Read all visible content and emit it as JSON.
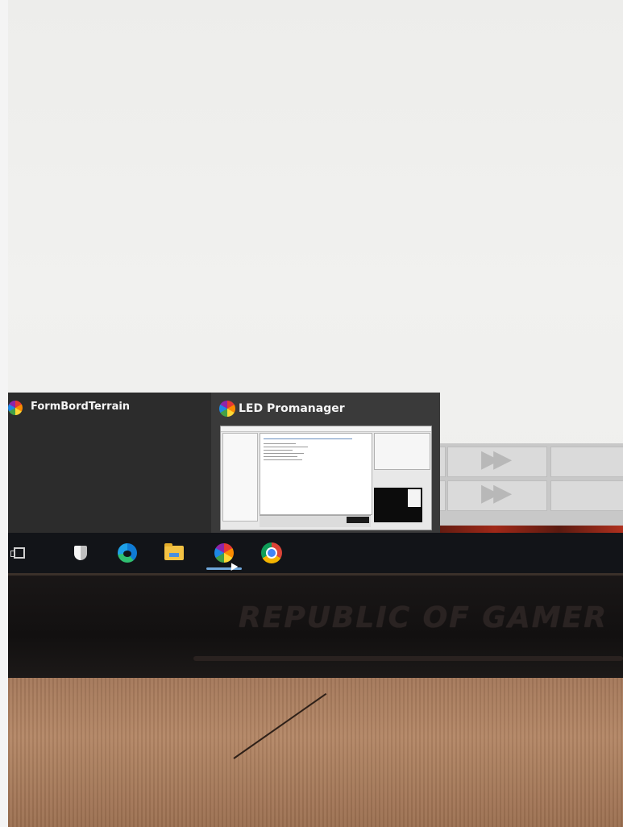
{
  "thumbnails": [
    {
      "title": "FormBordTerrain"
    },
    {
      "title": "LED Promanager"
    }
  ],
  "taskbar": {
    "items": [
      {
        "icon": "task-view-icon"
      },
      {
        "icon": "windows-security-icon"
      },
      {
        "icon": "edge-icon"
      },
      {
        "icon": "file-explorer-icon"
      },
      {
        "icon": "led-promanager-icon",
        "active": true
      },
      {
        "icon": "chrome-icon"
      }
    ]
  },
  "bezel": {
    "brand_text": "REPUBLIC OF GAMER"
  },
  "colors": {
    "taskbar_bg": "#121418",
    "thumbnail_bg": "#2c2c2c",
    "active_indicator": "#6fa8dc"
  }
}
